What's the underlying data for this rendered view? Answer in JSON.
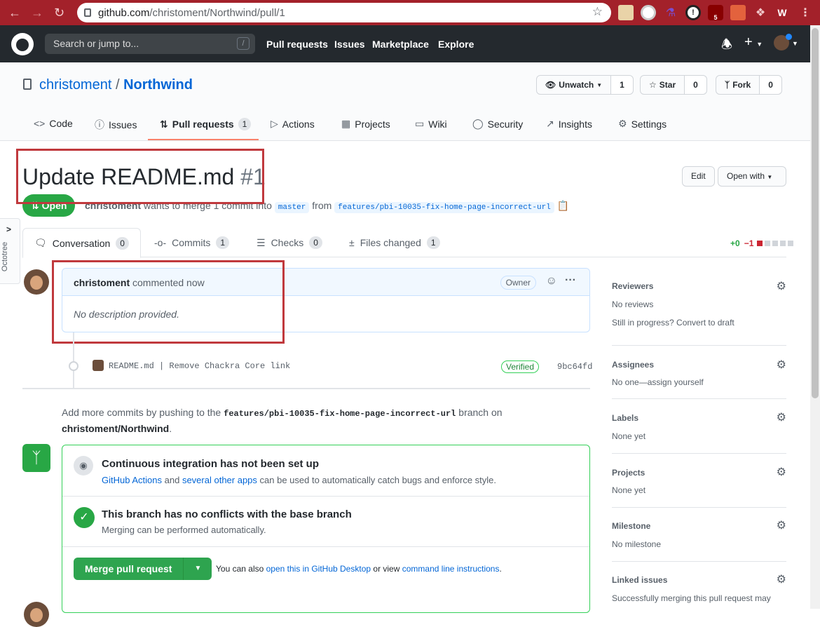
{
  "browser": {
    "url_host": "github.com",
    "url_path": "/christoment/Northwind/pull/1",
    "extension_badge": "5"
  },
  "header": {
    "search_placeholder": "Search or jump to...",
    "search_key": "/",
    "nav": [
      "Pull requests",
      "Issues",
      "Marketplace",
      "Explore"
    ]
  },
  "repo": {
    "owner": "christoment",
    "separator": "/",
    "name": "Northwind",
    "watch_label": "Unwatch",
    "watch_count": "1",
    "star_label": "Star",
    "star_count": "0",
    "fork_label": "Fork",
    "fork_count": "0",
    "tabs": [
      {
        "label": "Code",
        "icon": "code-icon"
      },
      {
        "label": "Issues",
        "icon": "issue-icon"
      },
      {
        "label": "Pull requests",
        "icon": "pull-request-icon",
        "count": "1"
      },
      {
        "label": "Actions",
        "icon": "play-icon"
      },
      {
        "label": "Projects",
        "icon": "project-icon"
      },
      {
        "label": "Wiki",
        "icon": "book-icon"
      },
      {
        "label": "Security",
        "icon": "shield-icon"
      },
      {
        "label": "Insights",
        "icon": "graph-icon"
      },
      {
        "label": "Settings",
        "icon": "gear-icon"
      }
    ]
  },
  "pr": {
    "title": "Update README.md",
    "number": "#1",
    "state": "Open",
    "author": "christoment",
    "meta_text": "wants to merge 1 commit into",
    "base_branch": "master",
    "from_text": "from",
    "head_branch": "features/pbi-10035-fix-home-page-incorrect-url",
    "edit_label": "Edit",
    "open_with_label": "Open with",
    "tabs": [
      {
        "label": "Conversation",
        "count": "0"
      },
      {
        "label": "Commits",
        "count": "1"
      },
      {
        "label": "Checks",
        "count": "0"
      },
      {
        "label": "Files changed",
        "count": "1"
      }
    ],
    "additions": "+0",
    "deletions": "−1"
  },
  "comment": {
    "author": "christoment",
    "action": "commented now",
    "badge": "Owner",
    "body": "No description provided."
  },
  "commit": {
    "message": "README.md | Remove Chackra Core link",
    "verified": "Verified",
    "sha": "9bc64fd"
  },
  "add_more": {
    "prefix": "Add more commits by pushing to the",
    "branch": "features/pbi-10035-fix-home-page-incorrect-url",
    "middle": "branch on",
    "repo": "christoment/Northwind",
    "suffix": "."
  },
  "merge": {
    "ci_title": "Continuous integration has not been set up",
    "ci_link1": "GitHub Actions",
    "ci_and": "and",
    "ci_link2": "several other apps",
    "ci_rest": "can be used to automatically catch bugs and enforce style.",
    "conflict_title": "This branch has no conflicts with the base branch",
    "conflict_sub": "Merging can be performed automatically.",
    "button": "Merge pull request",
    "also_text": "You can also",
    "desktop_link": "open this in GitHub Desktop",
    "or_view": "or view",
    "cli_link": "command line instructions",
    "period": "."
  },
  "sidebar": [
    {
      "label": "Reviewers",
      "value": "No reviews",
      "extra": "Still in progress? Convert to draft"
    },
    {
      "label": "Assignees",
      "value": "No one—assign yourself"
    },
    {
      "label": "Labels",
      "value": "None yet"
    },
    {
      "label": "Projects",
      "value": "None yet"
    },
    {
      "label": "Milestone",
      "value": "No milestone"
    },
    {
      "label": "Linked issues",
      "value": "Successfully merging this pull request may"
    }
  ],
  "octotree": {
    "label": "Octotree"
  },
  "colors": {
    "browser_bar": "#a3212a",
    "gh_header": "#24292e",
    "open_green": "#28a745",
    "link_blue": "#0366d6",
    "annotation_red": "#c0393d"
  }
}
